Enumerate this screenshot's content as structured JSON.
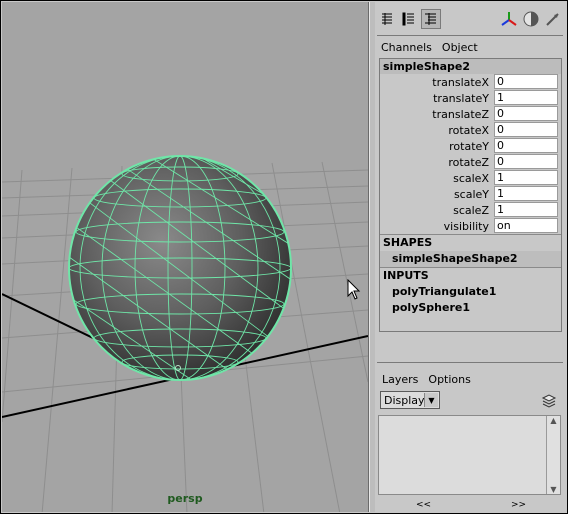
{
  "viewport": {
    "camera_label": "persp"
  },
  "toolbar": {
    "icons": [
      "channel-box-icon",
      "attribute-view-icon",
      "channel-layer-icon",
      "axis-icon",
      "shading-icon",
      "pick-icon"
    ]
  },
  "channel_box": {
    "menu": [
      "Channels",
      "Object"
    ],
    "object_name": "simpleShape2",
    "attributes": [
      {
        "label": "translateX",
        "value": "0"
      },
      {
        "label": "translateY",
        "value": "1"
      },
      {
        "label": "translateZ",
        "value": "0"
      },
      {
        "label": "rotateX",
        "value": "0"
      },
      {
        "label": "rotateY",
        "value": "0"
      },
      {
        "label": "rotateZ",
        "value": "0"
      },
      {
        "label": "scaleX",
        "value": "1"
      },
      {
        "label": "scaleY",
        "value": "1"
      },
      {
        "label": "scaleZ",
        "value": "1"
      },
      {
        "label": "visibility",
        "value": "on"
      }
    ],
    "shapes_header": "SHAPES",
    "shapes": [
      "simpleShapeShape2"
    ],
    "inputs_header": "INPUTS",
    "inputs": [
      "polyTriangulate1",
      "polySphere1"
    ]
  },
  "layers": {
    "menu": [
      "Layers",
      "Options"
    ],
    "display_select": "Display",
    "nav_left": "<<",
    "nav_right": ">>"
  },
  "colors": {
    "wireframe": "#6fe6a8",
    "viewport_bg": "#a4a4a4",
    "sphere_shade": "#5a5a5a"
  }
}
